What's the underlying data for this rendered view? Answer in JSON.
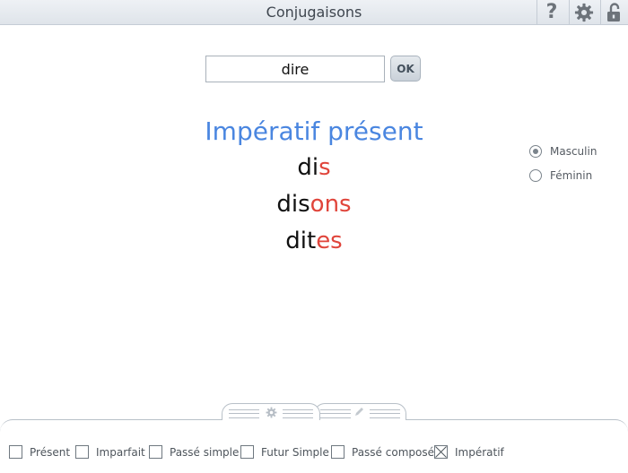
{
  "app": {
    "title": "Conjugaisons",
    "toolbar_icons": [
      "help-icon",
      "gear-icon",
      "lock-icon"
    ]
  },
  "search": {
    "value": "dire",
    "ok_label": "OK"
  },
  "conjugation": {
    "tense": "Impératif présent",
    "lines": [
      {
        "stem": "di",
        "ending": "s"
      },
      {
        "stem": "dis",
        "ending": "ons"
      },
      {
        "stem": "dit",
        "ending": "es"
      }
    ]
  },
  "gender": {
    "options": [
      {
        "label": "Masculin",
        "checked": true
      },
      {
        "label": "Féminin",
        "checked": false
      }
    ]
  },
  "bottom": {
    "tabs": [
      "settings-tab",
      "edit-tab"
    ],
    "tenses": [
      {
        "label": "Présent",
        "checked": false
      },
      {
        "label": "Imparfait",
        "checked": false
      },
      {
        "label": "Passé simple",
        "checked": false
      },
      {
        "label": "Futur Simple",
        "checked": false
      },
      {
        "label": "Passé composé",
        "checked": false
      },
      {
        "label": "Impératif",
        "checked": true
      }
    ]
  },
  "colors": {
    "tense_title": "#4a86e0",
    "ending": "#e0453b"
  }
}
